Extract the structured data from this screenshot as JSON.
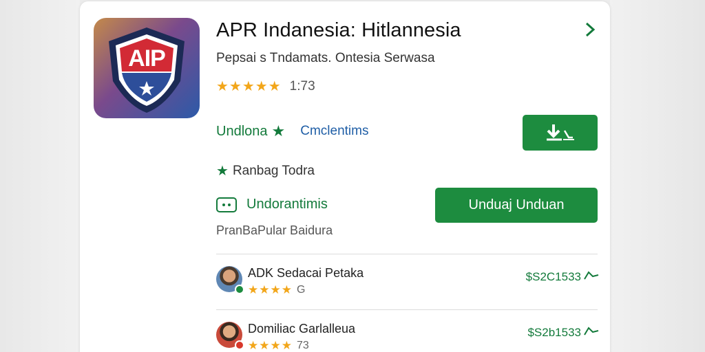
{
  "app": {
    "title": "APR Indanesia: Hitlannesia",
    "subtitle": "Pepsai s Tndamats. Ontesia Serwasa",
    "rating_stars": "★★★★★",
    "rating_count": "1:73",
    "icon_text": "AIP",
    "icon_name": "shield-logo-icon"
  },
  "actions": {
    "download_link": "Undlona",
    "comments_link": "Cmclentims",
    "download_icon_button_label": "",
    "badge_label": "Ranbag Todra",
    "reviews_label": "Undorantimis",
    "primary_button": "Unduaj Unduan",
    "footer_text": "PranBaPular Baidura"
  },
  "colors": {
    "accent_green": "#1d8c3f",
    "text_green": "#137a3b",
    "link_blue": "#1f5ea6",
    "star_gold": "#f2a61a"
  },
  "list": [
    {
      "name": "ADK Sedacai Petaka",
      "stars": "★★★★",
      "count": "G",
      "price": "$S2C1533",
      "badge_color": "#1d8c3f"
    },
    {
      "name": "Domiliac Garlalleua",
      "stars": "★★★★",
      "count": "73",
      "price": "$S2b1533",
      "badge_color": "#d8382b"
    }
  ]
}
